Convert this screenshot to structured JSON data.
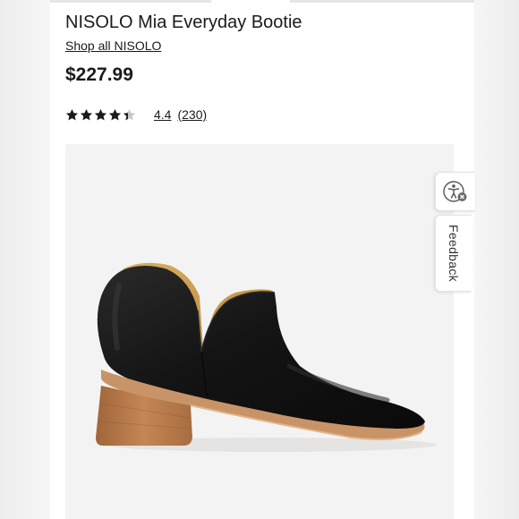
{
  "product": {
    "title": "NISOLO Mia Everyday Bootie",
    "shop_link": "Shop all NISOLO",
    "price": "$227.99",
    "rating": {
      "value": "4.4",
      "count": "(230)",
      "stars": 4.4,
      "max_stars": 5
    },
    "image": {
      "subject": "black leather ankle bootie with stacked wooden heel"
    }
  },
  "feedback": {
    "label": "Feedback"
  },
  "icons": {
    "accessibility": "accessibility-icon",
    "star": "star-icon"
  },
  "colors": {
    "text": "#1a1a1a",
    "boot_leather": "#121212",
    "boot_lining": "#c99a4b",
    "boot_heel": "#b97a4a"
  }
}
